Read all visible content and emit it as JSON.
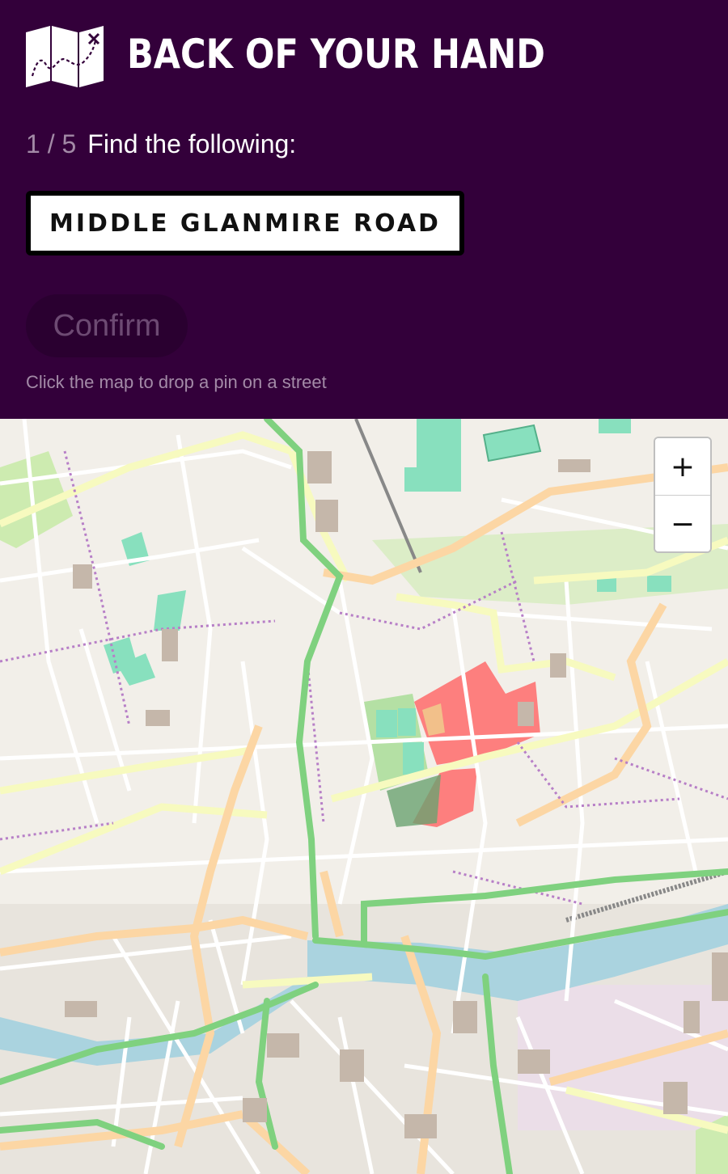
{
  "app": {
    "title": "BACK OF YOUR HAND"
  },
  "quiz": {
    "progress": "1 / 5",
    "prompt": "Find the following:",
    "target_street": "MIDDLE GLANMIRE ROAD",
    "confirm_label": "Confirm",
    "hint": "Click the map to drop a pin on a street"
  },
  "map": {
    "zoom_in_label": "+",
    "zoom_out_label": "−"
  },
  "colors": {
    "header_bg": "#33003a",
    "water": "#aad3df",
    "park": "#c8facc",
    "pitch": "#88e0be",
    "highlight": "#ff5b5b",
    "primary_road": "#fcd6a4",
    "secondary_road": "#f7fabf",
    "cycleway": "#7fd17f"
  }
}
